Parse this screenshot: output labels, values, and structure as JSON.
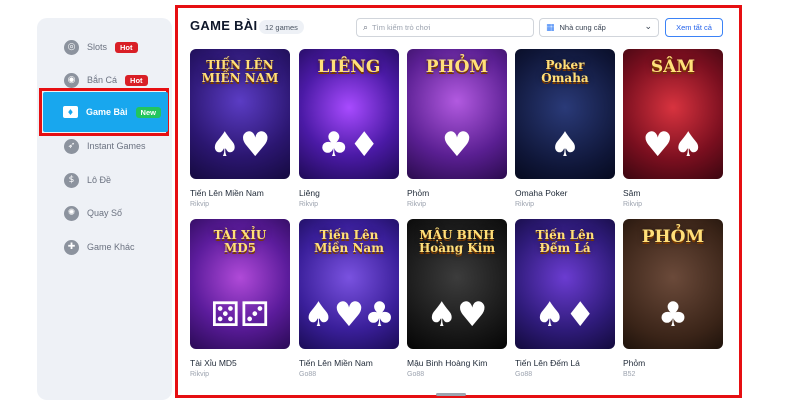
{
  "sidebar": {
    "items": [
      {
        "label": "Slots",
        "badge": "Hot",
        "icon": "slot-machine-icon",
        "glyph": "◎"
      },
      {
        "label": "Bắn Cá",
        "badge": "Hot",
        "icon": "fish-icon",
        "glyph": "◉"
      },
      {
        "label": "Game Bài",
        "badge": "New",
        "icon": "cards-icon",
        "glyph": "♦",
        "active": true
      },
      {
        "label": "Instant Games",
        "badge": "",
        "icon": "rocket-icon",
        "glyph": "➶"
      },
      {
        "label": "Lô Đề",
        "badge": "",
        "icon": "dollar-icon",
        "glyph": "$"
      },
      {
        "label": "Quay Số",
        "badge": "",
        "icon": "lottery-wheel-icon",
        "glyph": "✺"
      },
      {
        "label": "Game Khác",
        "badge": "",
        "icon": "puzzle-icon",
        "glyph": "✚"
      }
    ]
  },
  "header": {
    "title": "GAME BÀI",
    "count": "12 games",
    "search_placeholder": "Tìm kiếm trò chơi",
    "provider_label": "Nhà cung cấp",
    "see_all": "Xem tất cả"
  },
  "colors": {
    "accent": "#18a7ee",
    "highlight_frame": "#e60f12",
    "hot_badge": "#d91f26",
    "new_badge": "#22c55e"
  },
  "games": [
    {
      "name": "Tiến Lên Miền Nam",
      "provider": "Rikvip",
      "logo": "TIẾN LÊN\nMIỀN NAM",
      "deco": "♠♥",
      "bg": "bg-blue"
    },
    {
      "name": "Liêng",
      "provider": "Rikvip",
      "logo": "LIÊNG",
      "deco": "♣♦",
      "bg": "bg-purple"
    },
    {
      "name": "Phỏm",
      "provider": "Rikvip",
      "logo": "PHỎM",
      "deco": "♥",
      "bg": "bg-violet"
    },
    {
      "name": "Omaha Poker",
      "provider": "Rikvip",
      "logo": "Poker\nOmaha",
      "deco": "♠",
      "bg": "bg-dark"
    },
    {
      "name": "Sâm",
      "provider": "Rikvip",
      "logo": "SÂM",
      "deco": "♥♠",
      "bg": "bg-red"
    },
    {
      "name": "Tài Xỉu MD5",
      "provider": "Rikvip",
      "logo": "TÀI XỈU\nMD5",
      "deco": "⚄⚂",
      "bg": "bg-sky"
    },
    {
      "name": "Tiến Lên Miền Nam",
      "provider": "Go88",
      "logo": "Tiến Lên\nMiền Nam",
      "deco": "♠♥♣",
      "bg": "bg-orange"
    },
    {
      "name": "Mậu Binh Hoàng Kim",
      "provider": "Go88",
      "logo": "MẬU BINH\nHoàng Kim",
      "deco": "♠♥",
      "bg": "bg-gold"
    },
    {
      "name": "Tiến Lên Đếm Lá",
      "provider": "Go88",
      "logo": "Tiến Lên\nĐếm Lá",
      "deco": "♠♦",
      "bg": "bg-teal"
    },
    {
      "name": "Phỏm",
      "provider": "B52",
      "logo": "PHỎM",
      "deco": "♣",
      "bg": "bg-brown"
    }
  ]
}
